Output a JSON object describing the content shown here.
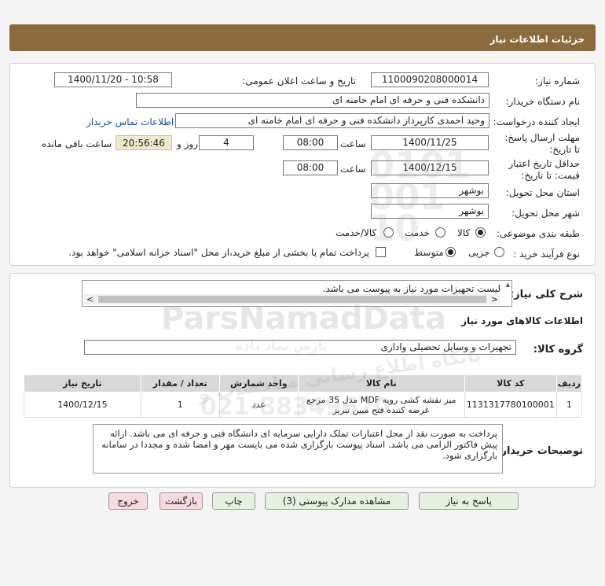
{
  "page": {
    "title": "جزئیات اطلاعات نیاز"
  },
  "form": {
    "need_number_label": "شماره نیاز:",
    "need_number": "1100090208000014",
    "announce_label": "تاریخ و ساعت اعلان عمومی:",
    "announce_value": "1400/11/20 - 10:58",
    "buyer_label": "نام دستگاه خریدار:",
    "buyer_value": "دانشکده فنی و حرفه ای امام خامنه ای",
    "creator_label": "ایجاد کننده درخواست:",
    "creator_value": "وحید احمدی کارپرداز دانشکده فنی و حرفه ای امام خامنه ای",
    "contact_link": "اطلاعات تماس خریدار",
    "deadline_label": "مهلت ارسال پاسخ: تا تاریخ:",
    "deadline_date": "1400/11/25",
    "time_label": "ساعت",
    "deadline_time": "08:00",
    "days_value": "4",
    "days_label": "روز و",
    "remaining_value": "20:56:46",
    "remaining_label": "ساعت باقی مانده",
    "validity_label": "حداقل تاریخ اعتبار قیمت: تا تاریخ:",
    "validity_date": "1400/12/15",
    "validity_time": "08:00",
    "province_label": "استان محل تحویل:",
    "province_value": "بوشهر",
    "city_label": "شهر محل تحویل:",
    "city_value": "بوشهر",
    "category_label": "طبقه بندی موضوعی:",
    "category_options": [
      "کالا",
      "خدمت",
      "کالا/خدمت"
    ],
    "category_selected": "کالا",
    "process_label": "نوع فرآیند خرید :",
    "process_options": [
      "جزیی",
      "متوسط"
    ],
    "process_selected": "متوسط",
    "payment_note": "پرداخت تمام یا بخشی از مبلغ خرید،از محل \"اسناد خزانه اسلامی\" خواهد بود."
  },
  "summary": {
    "label": "شرح کلی نیاز:",
    "text": "لیست تجهیزات مورد نیاز  به پیوست می باشد."
  },
  "goods": {
    "section_title": "اطلاعات کالاهای مورد نیاز",
    "group_label": "گروه کالا:",
    "group_value": "تجهیزات و وسایل تحصیلی واداری",
    "columns": [
      "ردیف",
      "کد کالا",
      "نام کالا",
      "واحد شمارش",
      "تعداد / مقدار",
      "تاریخ نیاز"
    ],
    "rows": [
      {
        "row": "1",
        "code": "1131317780100001",
        "name": "میز نقشه کشی رویه MDF مدل 35 مرجع عرضه کننده فتح مبین تبریز",
        "unit": "عدد",
        "qty": "1",
        "date": "1400/12/15"
      }
    ]
  },
  "buyer_notes": {
    "label": "توضیحات خریدار:",
    "text": "پرداخت به صورت نقد از محل اعتبارات تملک دارایی سرمایه ای دانشگاه فنی و حرفه ای می باشد. ارائه پیش فاکتور الزامی می باشد. اسناد پیوست بارگزاری شده می بایست مهر و امضا شده و مجددا در سامانه بارگزاری شود."
  },
  "buttons": {
    "reply": "پاسخ به نیاز",
    "attachments": "مشاهده مدارک پیوستی (3)",
    "print": "چاپ",
    "back": "بازگشت",
    "exit": "خروج"
  },
  "watermark": {
    "brand": "ParsNamadData",
    "line1": "پایگاه اطلاع رسانی مناقصات و",
    "line2": "پارس نماد داده",
    "phone": "021-88349670",
    "numbers": "0101 001 10"
  }
}
